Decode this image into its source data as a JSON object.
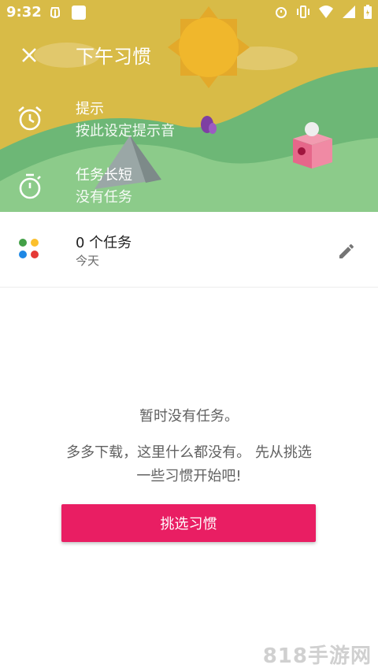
{
  "status_bar": {
    "time": "9:32",
    "icons": [
      "bug-icon",
      "square-icon",
      "alarm-icon",
      "vibrate-icon",
      "wifi-icon",
      "signal-icon",
      "battery-icon"
    ]
  },
  "header": {
    "close_icon": "close-icon",
    "title": "下午习惯",
    "reminder": {
      "icon": "alarm-clock-icon",
      "label": "提示",
      "value": "按此设定提示音"
    },
    "duration": {
      "icon": "stopwatch-icon",
      "label": "任务长短",
      "value": "没有任务"
    }
  },
  "summary": {
    "count_text": "0 个任务",
    "date_text": "今天",
    "edit_icon": "pencil-icon",
    "dot_colors": [
      "#43a047",
      "#fbc02d",
      "#1e88e5",
      "#e53935"
    ]
  },
  "empty_state": {
    "title": "暂时没有任务。",
    "message": "多多下载，这里什么都没有。 先从挑选一些习惯开始吧!",
    "button_label": "挑选习惯"
  },
  "watermark": "818手游网",
  "colors": {
    "banner_sky": "#d9bc48",
    "hill_dark": "#5fae74",
    "hill_light": "#8ecb8e",
    "accent": "#e91e63"
  }
}
